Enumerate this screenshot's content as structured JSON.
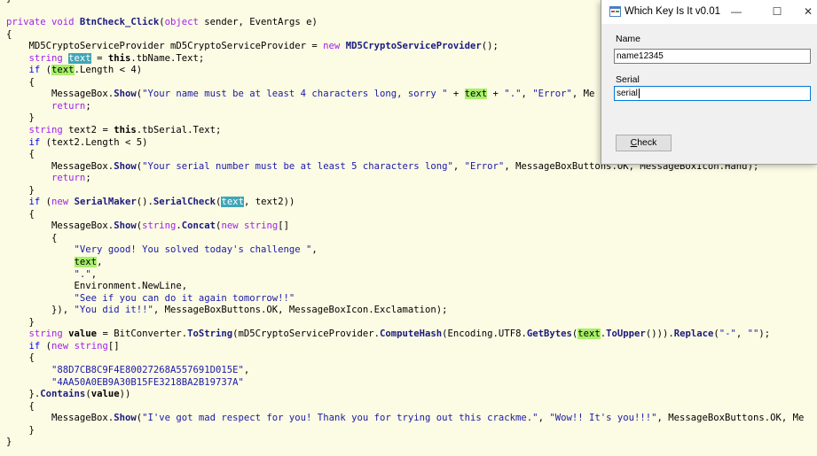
{
  "code": {
    "lines": [
      [
        {
          "t": "}"
        }
      ],
      [
        {
          "t": ""
        }
      ],
      [
        {
          "t": "private void ",
          "c": "kw"
        },
        {
          "t": "BtnCheck_Click",
          "c": "fn"
        },
        {
          "t": "("
        },
        {
          "t": "object",
          "c": "kw"
        },
        {
          "t": " sender, EventArgs e)"
        }
      ],
      [
        {
          "t": "{"
        }
      ],
      [
        {
          "t": "    MD5CryptoServiceProvider mD5CryptoServiceProvider = "
        },
        {
          "t": "new ",
          "c": "kw"
        },
        {
          "t": "MD5CryptoServiceProvider",
          "c": "fn"
        },
        {
          "t": "();"
        }
      ],
      [
        {
          "t": "    "
        },
        {
          "t": "string ",
          "c": "kw"
        },
        {
          "t": "text",
          "c": "hl2"
        },
        {
          "t": " = "
        },
        {
          "t": "this",
          "c": "mb"
        },
        {
          "t": ".tbName.Text;"
        }
      ],
      [
        {
          "t": "    "
        },
        {
          "t": "if ",
          "c": "ty"
        },
        {
          "t": "("
        },
        {
          "t": "text",
          "c": "hl"
        },
        {
          "t": ".Length < 4)"
        }
      ],
      [
        {
          "t": "    {"
        }
      ],
      [
        {
          "t": "        MessageBox."
        },
        {
          "t": "Show",
          "c": "fn"
        },
        {
          "t": "("
        },
        {
          "t": "\"Your name must be at least 4 characters long, sorry \"",
          "c": "st"
        },
        {
          "t": " + "
        },
        {
          "t": "text",
          "c": "hl"
        },
        {
          "t": " + "
        },
        {
          "t": "\".\"",
          "c": "st"
        },
        {
          "t": ", "
        },
        {
          "t": "\"Error\"",
          "c": "st"
        },
        {
          "t": ", Me"
        }
      ],
      [
        {
          "t": "        "
        },
        {
          "t": "return",
          "c": "kw"
        },
        {
          "t": ";"
        }
      ],
      [
        {
          "t": "    }"
        }
      ],
      [
        {
          "t": "    "
        },
        {
          "t": "string ",
          "c": "kw"
        },
        {
          "t": "text2 = "
        },
        {
          "t": "this",
          "c": "mb"
        },
        {
          "t": ".tbSerial.Text;"
        }
      ],
      [
        {
          "t": "    "
        },
        {
          "t": "if ",
          "c": "ty"
        },
        {
          "t": "(text2.Length < 5)"
        }
      ],
      [
        {
          "t": "    {"
        }
      ],
      [
        {
          "t": "        MessageBox."
        },
        {
          "t": "Show",
          "c": "fn"
        },
        {
          "t": "("
        },
        {
          "t": "\"Your serial number must be at least 5 characters long\"",
          "c": "st"
        },
        {
          "t": ", "
        },
        {
          "t": "\"Error\"",
          "c": "st"
        },
        {
          "t": ", MessageBoxButtons.OK, MessageBoxIcon.Hand);"
        }
      ],
      [
        {
          "t": "        "
        },
        {
          "t": "return",
          "c": "kw"
        },
        {
          "t": ";"
        }
      ],
      [
        {
          "t": "    }"
        }
      ],
      [
        {
          "t": "    "
        },
        {
          "t": "if ",
          "c": "ty"
        },
        {
          "t": "("
        },
        {
          "t": "new ",
          "c": "kw"
        },
        {
          "t": "SerialMaker",
          "c": "fn"
        },
        {
          "t": "()."
        },
        {
          "t": "SerialCheck",
          "c": "fn"
        },
        {
          "t": "("
        },
        {
          "t": "text",
          "c": "hl2"
        },
        {
          "t": ", text2))"
        }
      ],
      [
        {
          "t": "    {"
        }
      ],
      [
        {
          "t": "        MessageBox."
        },
        {
          "t": "Show",
          "c": "fn"
        },
        {
          "t": "("
        },
        {
          "t": "string",
          "c": "kw"
        },
        {
          "t": "."
        },
        {
          "t": "Concat",
          "c": "fn"
        },
        {
          "t": "("
        },
        {
          "t": "new ",
          "c": "kw"
        },
        {
          "t": "string",
          "c": "kw"
        },
        {
          "t": "[]"
        }
      ],
      [
        {
          "t": "        {"
        }
      ],
      [
        {
          "t": "            "
        },
        {
          "t": "\"Very good! You solved today's challenge \"",
          "c": "st"
        },
        {
          "t": ","
        }
      ],
      [
        {
          "t": "            "
        },
        {
          "t": "text",
          "c": "hl"
        },
        {
          "t": ","
        }
      ],
      [
        {
          "t": "            "
        },
        {
          "t": "\".\"",
          "c": "st"
        },
        {
          "t": ","
        }
      ],
      [
        {
          "t": "            Environment.NewLine,"
        }
      ],
      [
        {
          "t": "            "
        },
        {
          "t": "\"See if you can do it again tomorrow!!\"",
          "c": "st"
        }
      ],
      [
        {
          "t": "        }), "
        },
        {
          "t": "\"You did it!!\"",
          "c": "st"
        },
        {
          "t": ", MessageBoxButtons.OK, MessageBoxIcon.Exclamation);"
        }
      ],
      [
        {
          "t": "    }"
        }
      ],
      [
        {
          "t": "    "
        },
        {
          "t": "string ",
          "c": "kw"
        },
        {
          "t": "value",
          "c": "mb"
        },
        {
          "t": " = BitConverter."
        },
        {
          "t": "ToString",
          "c": "fn"
        },
        {
          "t": "(mD5CryptoServiceProvider."
        },
        {
          "t": "ComputeHash",
          "c": "fn"
        },
        {
          "t": "(Encoding.UTF8."
        },
        {
          "t": "GetBytes",
          "c": "fn"
        },
        {
          "t": "("
        },
        {
          "t": "text",
          "c": "hl"
        },
        {
          "t": "."
        },
        {
          "t": "ToUpper",
          "c": "fn"
        },
        {
          "t": "()))."
        },
        {
          "t": "Replace",
          "c": "fn"
        },
        {
          "t": "("
        },
        {
          "t": "\"-\"",
          "c": "st"
        },
        {
          "t": ", "
        },
        {
          "t": "\"\"",
          "c": "st"
        },
        {
          "t": ");"
        }
      ],
      [
        {
          "t": "    "
        },
        {
          "t": "if ",
          "c": "ty"
        },
        {
          "t": "("
        },
        {
          "t": "new ",
          "c": "kw"
        },
        {
          "t": "string",
          "c": "kw"
        },
        {
          "t": "[]"
        }
      ],
      [
        {
          "t": "    {"
        }
      ],
      [
        {
          "t": "        "
        },
        {
          "t": "\"88D7CB8C9F4E80027268A557691D015E\"",
          "c": "st"
        },
        {
          "t": ","
        }
      ],
      [
        {
          "t": "        "
        },
        {
          "t": "\"4AA50A0EB9A30B15FE3218BA2B19737A\"",
          "c": "st"
        }
      ],
      [
        {
          "t": "    }."
        },
        {
          "t": "Contains",
          "c": "fn"
        },
        {
          "t": "("
        },
        {
          "t": "value",
          "c": "mb"
        },
        {
          "t": "))"
        }
      ],
      [
        {
          "t": "    {"
        }
      ],
      [
        {
          "t": "        MessageBox."
        },
        {
          "t": "Show",
          "c": "fn"
        },
        {
          "t": "("
        },
        {
          "t": "\"I've got mad respect for you! Thank you for trying out this crackme.\"",
          "c": "st"
        },
        {
          "t": ", "
        },
        {
          "t": "\"Wow!! It's you!!!\"",
          "c": "st"
        },
        {
          "t": ", MessageBoxButtons.OK, Me"
        }
      ],
      [
        {
          "t": "    }"
        }
      ],
      [
        {
          "t": "}"
        }
      ]
    ]
  },
  "dialog": {
    "title": "Which Key Is It v0.01",
    "minimize_glyph": "—",
    "maximize_glyph": "☐",
    "close_glyph": "✕",
    "name_label": "Name",
    "name_value": "name12345",
    "serial_label": "Serial",
    "serial_value": "serial",
    "check_label": "Check",
    "app_icon": "winforms-app-icon"
  },
  "colors": {
    "editor_background": "#fcfbe4",
    "keyword": "#a020f0",
    "string": "#1a1aa6",
    "highlight_green": "#a8f06a",
    "highlight_teal": "#3fa6b8"
  }
}
